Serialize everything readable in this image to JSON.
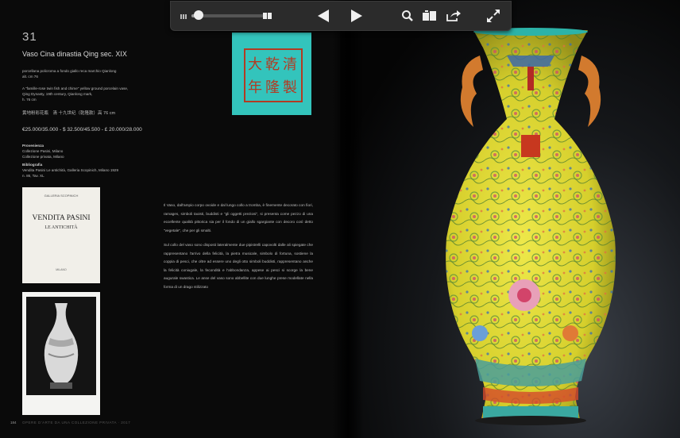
{
  "toolbar": {
    "icons": [
      "grip-icon",
      "slider",
      "single-page-icon",
      "prev-arrow-icon",
      "next-arrow-icon",
      "search-icon",
      "pages-icon",
      "share-icon",
      "fullscreen-icon"
    ],
    "slider_progress": 0.1
  },
  "lot": {
    "number": "31",
    "title": "Vaso Cina dinastia Qing sec. XIX",
    "it_desc_1": "porcellana policroma a fondo giallo reca marchio Qianlong",
    "it_desc_2": "alt. cm 76",
    "en_desc_1": "A \"famille-rose twin fish and chime\" yellow ground porcelain vase,",
    "en_desc_2": "Qing Dynasty, 19th century, Qianlong mark,",
    "en_desc_3": "h. 76 cm",
    "cn_desc": "黄地粉彩花瓶　清 十九世纪（乾隆款）高 76 cm",
    "estimate": "€25.000/35.000 - $ 32.500/45.500 - £ 20.000/28.000"
  },
  "provenance": {
    "heading": "Provenienza",
    "line1": "Collezione Pasini, Milano",
    "line2": "Collezione privata, Milano"
  },
  "bibliography": {
    "heading": "Bibliografia",
    "line1": "Vendita Pasini Le antichità, Galleria Scopinich, Milano 1929",
    "line2": "n. 86, Tav. XL"
  },
  "book": {
    "top_line": "GALLERIA SCOPINICH",
    "title": "VENDITA PASINI",
    "subtitle": "LE ANTICHITÀ",
    "bottom_line": "MILANO"
  },
  "body": {
    "paragraph1": "Il Vaso, dall'ampio corpo ovoide e dal lungo collo a tromba, è finemente decorato con fiori, ramages, simboli taoisti, buddisti e \"gli oggetti preziosi\", si presenta come pezzo di una eccellente qualità pittorica sia per il fondo di un giallo sgargiante con decoro così detto \"vegetale\", che per gli smalti.",
    "paragraph2": "Sul collo del vaso sono disposti lateralmente due pipistrelli capovolti dalle ali spiegate che rappresentano l'arrivo della felicità, la pietra musicale, simbolo di fortuna, sostiene la coppia di pesci, che oltre ad essere uno degli otto simboli buddisti, rappresentano anche la felicità coniugale, la fecondità e l'abbondanza, appese ai pesci si scorge la bene augurale swastica. Le anse del vaso sono abbellite con due lunghe prese modellate nella forma di un drago stilizzato"
  },
  "footer": {
    "folio": "184",
    "text": "OPERE D'ARTE DA UNA COLLEZIONE PRIVATA · 2017"
  },
  "colors": {
    "vase_yellow": "#e4dc3a",
    "seal_turquoise": "#33c4bc",
    "seal_red": "#b33a22",
    "handle_orange": "#d27a2e"
  }
}
